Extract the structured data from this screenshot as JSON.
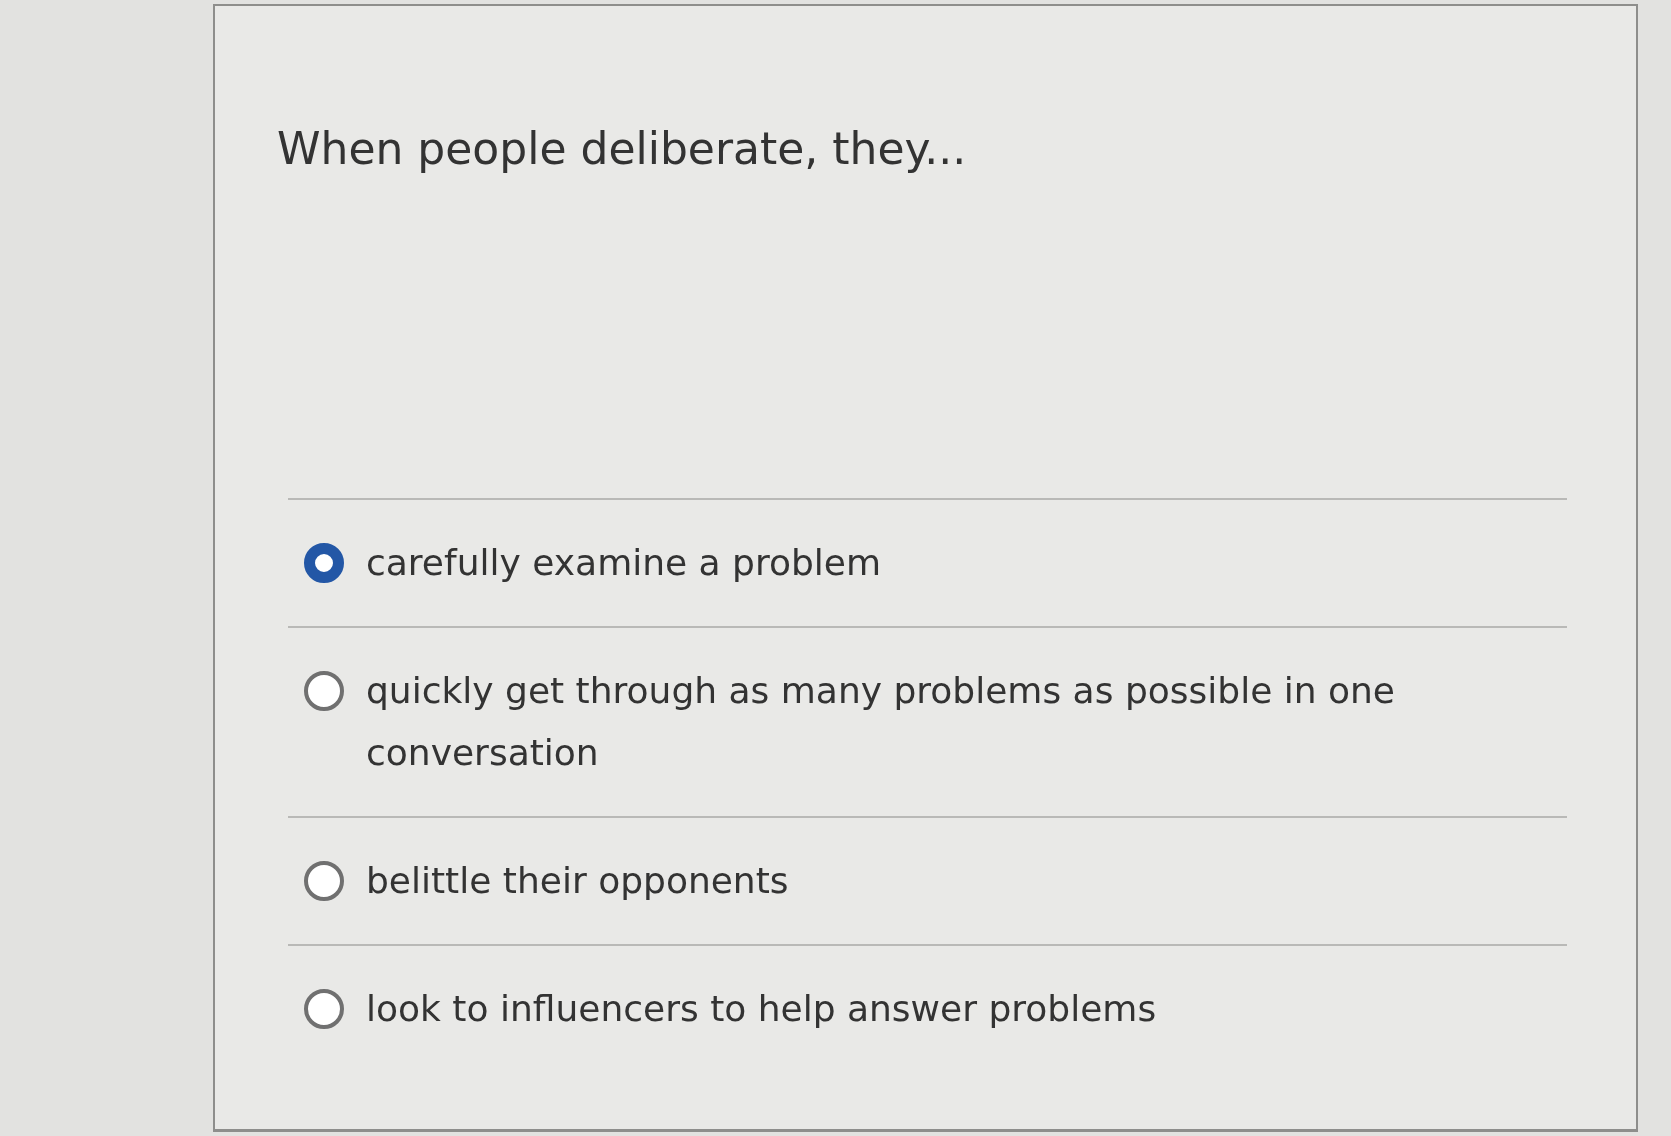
{
  "question": "When people deliberate, they...",
  "options": [
    {
      "label": "carefully examine a problem",
      "selected": true
    },
    {
      "label": "quickly get through as many problems as possible in one conversation",
      "selected": false
    },
    {
      "label": "belittle their opponents",
      "selected": false
    },
    {
      "label": "look to influencers to help answer problems",
      "selected": false
    }
  ]
}
